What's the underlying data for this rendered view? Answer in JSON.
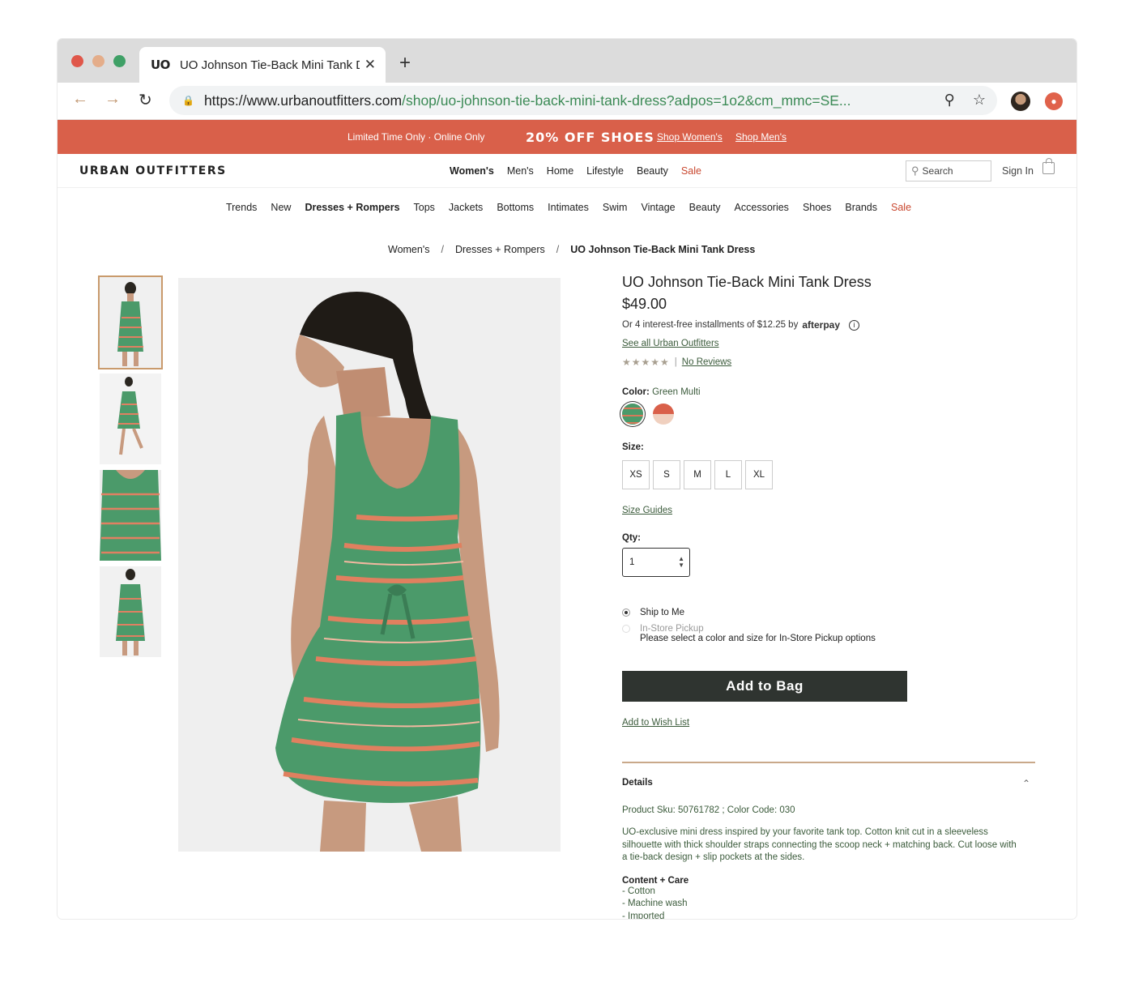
{
  "browser": {
    "tab_favicon": "UO",
    "tab_title": "UO Johnson Tie-Back Mini Tank Dress | Urban Outfitters",
    "tab_close": "✕",
    "new_tab": "+",
    "url_host": "https://www.urbanoutfitters.com",
    "url_path": "/shop/uo-johnson-tie-back-mini-tank-dress?adpos=1o2&cm_mmc=SE..."
  },
  "promo": {
    "left": "Limited Time Only · Online Only",
    "headline": "20% OFF SHOES",
    "link_women": "Shop Women's",
    "link_men": "Shop Men's"
  },
  "header": {
    "logo": "URBAN OUTFITTERS",
    "nav": [
      "Women's",
      "Men's",
      "Home",
      "Lifestyle",
      "Beauty",
      "Sale"
    ],
    "search_placeholder": "Search",
    "sign_in": "Sign In"
  },
  "categories": [
    "Trends",
    "New",
    "Dresses + Rompers",
    "Tops",
    "Jackets",
    "Bottoms",
    "Intimates",
    "Swim",
    "Vintage",
    "Beauty",
    "Accessories",
    "Shoes",
    "Brands",
    "Sale"
  ],
  "breadcrumb": {
    "items": [
      "Women's",
      "Dresses + Rompers",
      "UO Johnson Tie-Back Mini Tank Dress"
    ],
    "separator": "/"
  },
  "product": {
    "title": "UO Johnson Tie-Back Mini Tank Dress",
    "price": "$49.00",
    "afterpay_text": "Or 4 interest-free installments of $12.25 by",
    "afterpay_brand": "afterpay",
    "see_all": "See all Urban Outfitters",
    "stars": "★★★★★",
    "reviews": "No Reviews",
    "color_label": "Color:",
    "color_value": "Green Multi",
    "size_label": "Size:",
    "sizes": [
      "XS",
      "S",
      "M",
      "L",
      "XL"
    ],
    "size_guides": "Size Guides",
    "qty_label": "Qty:",
    "qty_value": "1",
    "ship_to_me": "Ship to Me",
    "in_store": "In-Store Pickup",
    "in_store_note": "Please select a color and size for In-Store Pickup options",
    "add_to_bag": "Add to Bag",
    "wish_list": "Add to Wish List",
    "details_title": "Details",
    "sku": "Product Sku: 50761782 ; Color Code: 030",
    "description": "UO-exclusive mini dress inspired by your favorite tank top. Cotton knit cut in a sleeveless silhouette with thick shoulder straps connecting the scoop neck + matching back. Cut loose with a tie-back design + slip pockets at the sides.",
    "care_title": "Content + Care",
    "care": [
      "- Cotton",
      "- Machine wash",
      "- Imported"
    ]
  },
  "colors": {
    "promo": "#d9604a",
    "accent_green": "#4b9a6a",
    "button_dark": "#2f3430",
    "sale_red": "#c9472f"
  }
}
